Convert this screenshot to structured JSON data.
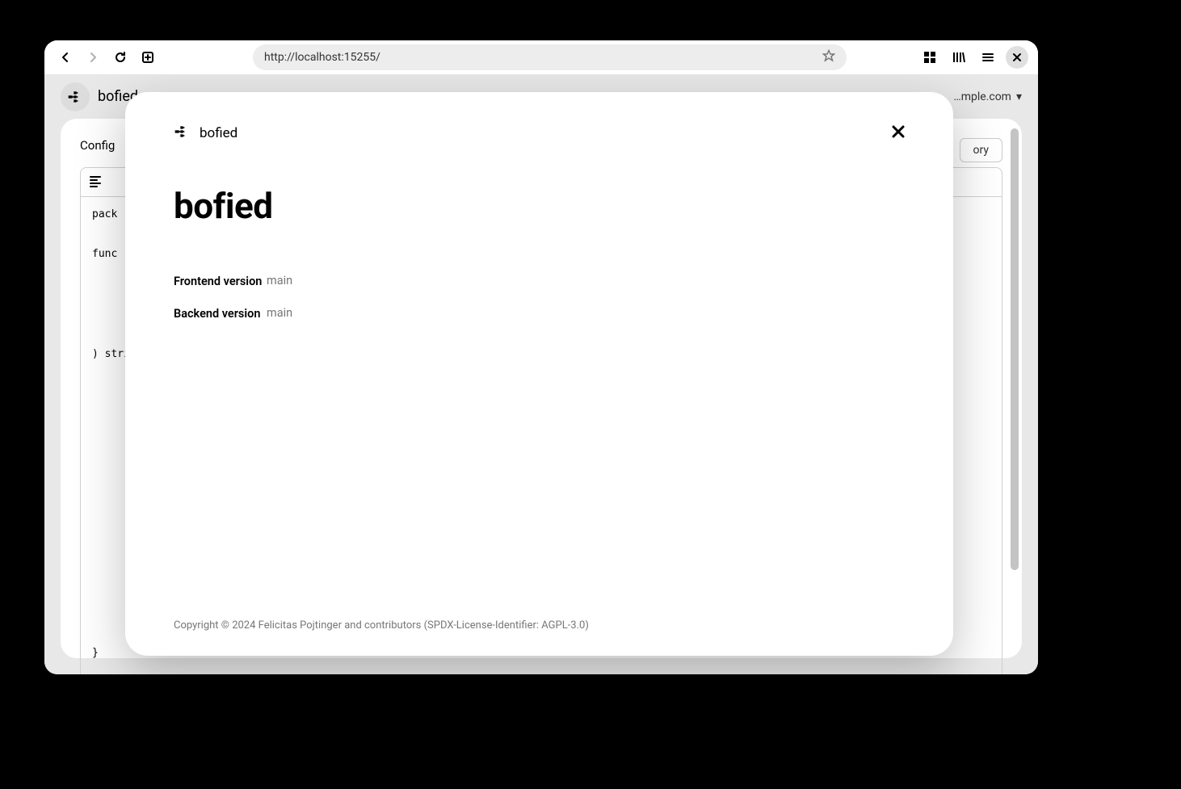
{
  "browser": {
    "url": "http://localhost:15255/"
  },
  "app": {
    "brand_name": "bofied",
    "user_email": "…mple.com",
    "panel_title": "Config",
    "action_button": "ory",
    "code_snippet": "pack\n\nfunc\n        i\n        r\n        a\n        a\n) stri\n        s\n        c\n\n        c\n\n        c\n\n        c\n\n        c\n\n        c\n\n        }\n}\n\nfunc"
  },
  "modal": {
    "brand_name": "bofied",
    "title": "bofied",
    "rows": [
      {
        "label": "Frontend version",
        "value": "main"
      },
      {
        "label": "Backend version",
        "value": "main"
      }
    ],
    "footer": "Copyright © 2024 Felicitas Pojtinger and contributors (SPDX-License-Identifier: AGPL-3.0)"
  }
}
